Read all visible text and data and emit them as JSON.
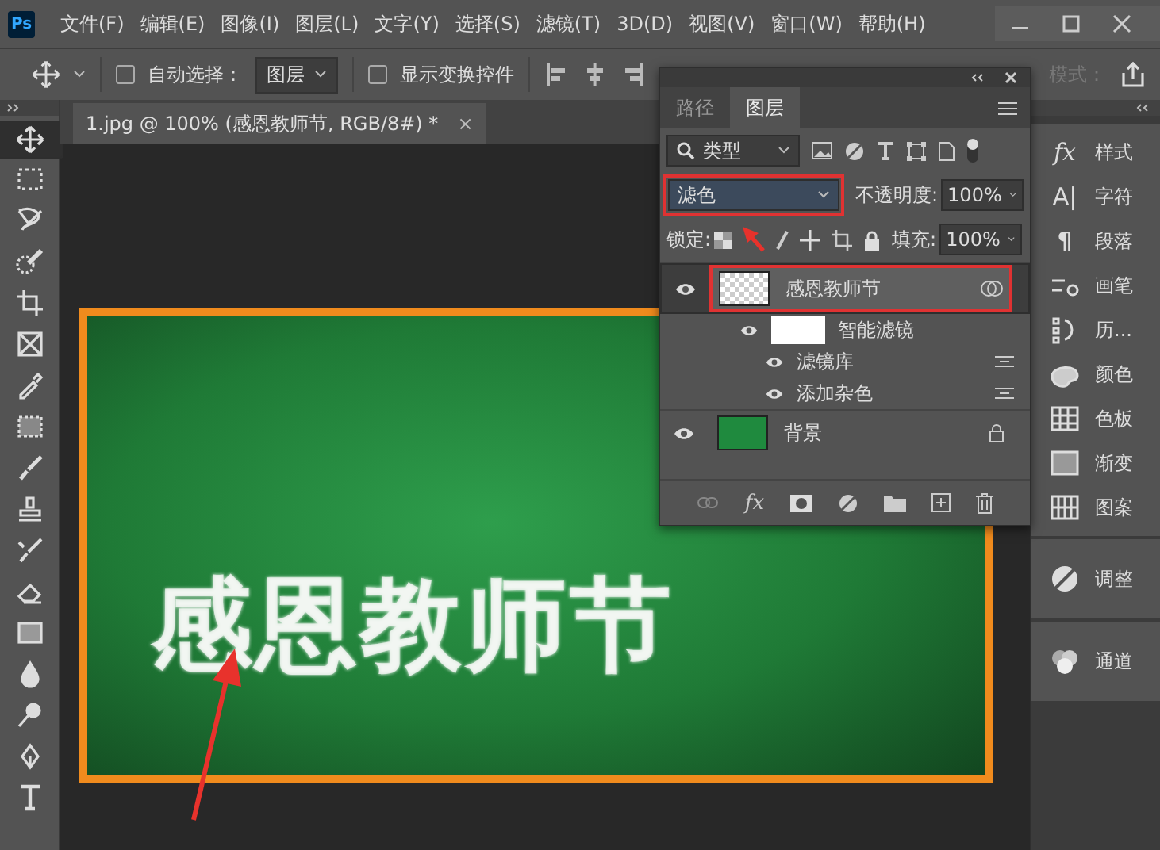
{
  "app": {
    "logo": "Ps",
    "menu": [
      "文件(F)",
      "编辑(E)",
      "图像(I)",
      "图层(L)",
      "文字(Y)",
      "选择(S)",
      "滤镜(T)",
      "3D(D)",
      "视图(V)",
      "窗口(W)",
      "帮助(H)"
    ]
  },
  "options_bar": {
    "auto_select": {
      "label": "自动选择：",
      "checked": false
    },
    "target": "图层",
    "show_transform": {
      "label": "显示变换控件",
      "checked": false
    },
    "mode_label": "模式："
  },
  "document_tab": {
    "title": "1.jpg @ 100% (感恩教师节, RGB/8#) *",
    "close": "×"
  },
  "tools": [
    {
      "kind": "move",
      "selected": true
    },
    {
      "kind": "marquee",
      "selected": false
    },
    {
      "kind": "lasso",
      "selected": false
    },
    {
      "kind": "quick-select",
      "selected": false
    },
    {
      "kind": "crop",
      "selected": false
    },
    {
      "kind": "frame",
      "selected": false
    },
    {
      "kind": "eyedropper",
      "selected": false
    },
    {
      "kind": "patch",
      "selected": false
    },
    {
      "kind": "brush",
      "selected": false
    },
    {
      "kind": "stamp",
      "selected": false
    },
    {
      "kind": "history-brush",
      "selected": false
    },
    {
      "kind": "eraser",
      "selected": false
    },
    {
      "kind": "gradient",
      "selected": false
    },
    {
      "kind": "blur",
      "selected": false
    },
    {
      "kind": "dodge",
      "selected": false
    },
    {
      "kind": "pen",
      "selected": false
    },
    {
      "kind": "type",
      "selected": false
    }
  ],
  "canvas": {
    "text": "感恩教师节"
  },
  "layers_panel": {
    "tabs": [
      {
        "label": "路径",
        "selected": false
      },
      {
        "label": "图层",
        "selected": true
      }
    ],
    "filter": "类型",
    "blend_mode": {
      "value": "滤色",
      "highlighted": true
    },
    "opacity_label": "不透明度:",
    "opacity": "100%",
    "lock_label": "锁定:",
    "fill_label": "填充:",
    "fill": "100%",
    "layers": [
      {
        "name": "感恩教师节",
        "kind": "smart-object",
        "selected": true,
        "highlighted": true,
        "locked": false,
        "children": [
          {
            "name": "智能滤镜",
            "kind": "filter-mask",
            "children": [
              {
                "name": "滤镜库",
                "kind": "filter"
              },
              {
                "name": "添加杂色",
                "kind": "filter"
              }
            ]
          }
        ]
      },
      {
        "name": "背景",
        "kind": "background",
        "selected": false,
        "highlighted": false,
        "locked": true
      }
    ],
    "fx_label": "fx"
  },
  "dock": {
    "panels": [
      {
        "label": "样式",
        "kind": "style",
        "glyph": "fx"
      },
      {
        "label": "字符",
        "kind": "character",
        "glyph": "A|"
      },
      {
        "label": "段落",
        "kind": "paragraph",
        "glyph": "¶"
      },
      {
        "label": "画笔",
        "kind": "brush"
      },
      {
        "label": "历...",
        "kind": "history"
      },
      {
        "label": "颜色",
        "kind": "color"
      },
      {
        "label": "色板",
        "kind": "swatches"
      },
      {
        "label": "渐变",
        "kind": "gradient"
      },
      {
        "label": "图案",
        "kind": "pattern"
      }
    ],
    "groups": [
      {
        "label": "调整",
        "kind": "adjustments"
      },
      {
        "label": "通道",
        "kind": "channels"
      }
    ]
  }
}
